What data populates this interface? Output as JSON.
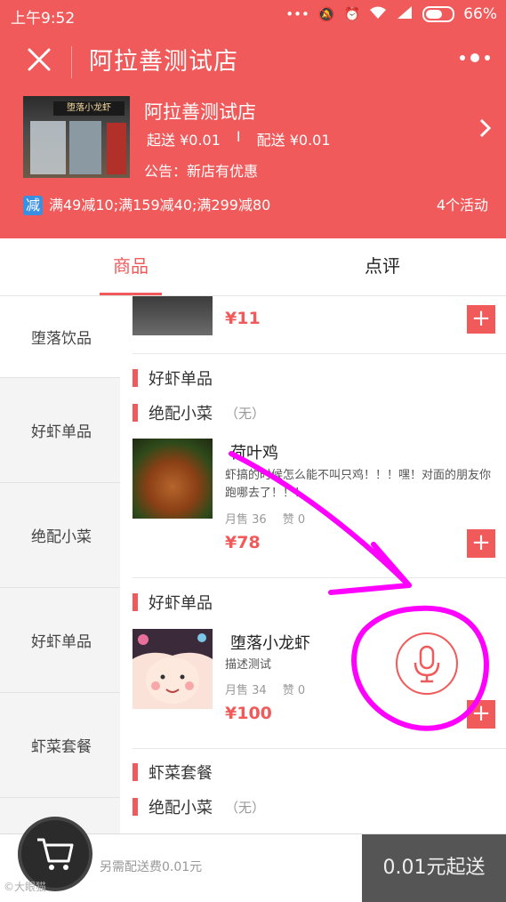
{
  "status_bar": {
    "time": "上午9:52",
    "battery": "66%"
  },
  "header": {
    "title": "阿拉善测试店",
    "shop_name": "阿拉善测试店",
    "shop_sign": "堕落小龙虾",
    "min_order": "起送 ¥0.01",
    "fee_sep": "I",
    "delivery_fee": "配送 ¥0.01",
    "notice": "公告：新店有优惠",
    "promo_badge": "减",
    "promo_text": "满49减10;满159减40;满299减80",
    "promo_count": "4个活动"
  },
  "tabs": {
    "goods": "商品",
    "reviews": "点评"
  },
  "sidebar": {
    "items": [
      {
        "label": "堕落饮品"
      },
      {
        "label": "好虾单品"
      },
      {
        "label": "绝配小菜"
      },
      {
        "label": "好虾单品"
      },
      {
        "label": "虾菜套餐"
      }
    ]
  },
  "content": {
    "top_item_price": "¥11",
    "section1_title": "好虾单品",
    "section2_title": "绝配小菜",
    "section2_note": "（无）",
    "product1": {
      "name": "荷叶鸡",
      "desc": "虾搞的时候怎么能不叫只鸡！！！嘿！对面的朋友你跑哪去了！！！",
      "sales": "月售 36",
      "likes": "赞 0",
      "price": "¥78"
    },
    "section3_title": "好虾单品",
    "product2": {
      "name": "堕落小龙虾",
      "desc": "描述测试",
      "sales": "月售 34",
      "likes": "赞 0",
      "price": "¥100"
    },
    "section4_title": "虾菜套餐",
    "section5_title": "绝配小菜",
    "section5_note": "（无）",
    "add_label": "+"
  },
  "cart": {
    "fee_text": "另需配送费0.01元",
    "cta": "0.01元起送"
  },
  "watermark": "©大眼猫",
  "colors": {
    "brand_red": "#f15a5a",
    "annotation_magenta": "#ff00ff",
    "promo_blue": "#3a8fe0"
  }
}
